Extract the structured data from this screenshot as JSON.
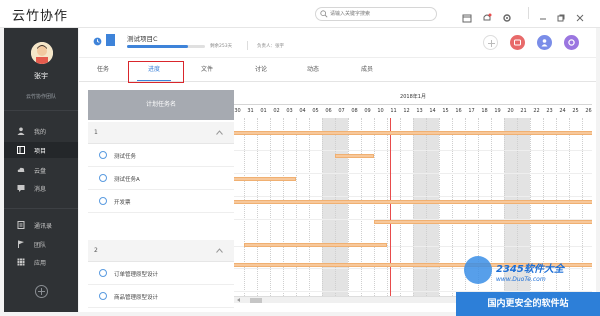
{
  "app": {
    "title": "云竹协作"
  },
  "search": {
    "placeholder": "请输入关键字搜索"
  },
  "user": {
    "name": "张宇",
    "org": "云竹协作团队"
  },
  "nav": [
    {
      "label": "我的",
      "icon": "person-icon"
    },
    {
      "label": "项目",
      "icon": "project-icon",
      "active": true
    },
    {
      "label": "云盘",
      "icon": "cloud-icon"
    },
    {
      "label": "消息",
      "icon": "message-icon"
    },
    {
      "label": "通讯录",
      "icon": "contacts-icon"
    },
    {
      "label": "团队",
      "icon": "flag-icon"
    },
    {
      "label": "应用",
      "icon": "apps-icon"
    }
  ],
  "project": {
    "name": "测试项目C",
    "progress": 0.78,
    "days": "剩余253天",
    "owner": "负责人：张宇"
  },
  "tabs": [
    {
      "label": "任务"
    },
    {
      "label": "进度",
      "active": true
    },
    {
      "label": "文件"
    },
    {
      "label": "讨论"
    },
    {
      "label": "动态"
    },
    {
      "label": "成员"
    }
  ],
  "task_panel": {
    "header": "计划任务名",
    "groups": [
      {
        "name": "1",
        "tasks": [
          "测试任务",
          "测试任务A",
          "开发票"
        ]
      },
      {
        "name": "2",
        "tasks": [
          "订单管理原型设计",
          "商品管理原型设计"
        ]
      }
    ]
  },
  "gantt": {
    "month": "2018年1月",
    "days": [
      "30",
      "31",
      "01",
      "02",
      "03",
      "04",
      "05",
      "06",
      "07",
      "08",
      "09",
      "10",
      "11",
      "12",
      "13",
      "14",
      "15",
      "16",
      "17",
      "18",
      "19",
      "20",
      "21",
      "22",
      "23",
      "24",
      "25",
      "26"
    ]
  },
  "watermark": {
    "title": "2345软件大全",
    "url": "www.DuoTe.com",
    "tagline": "国内更安全的软件站"
  },
  "colors": {
    "accent": "#3e83d9",
    "sidebar": "#2f3235",
    "today_line": "#e84b4b",
    "bar": "#f7c89b",
    "highlight_box": "#d9262c"
  }
}
